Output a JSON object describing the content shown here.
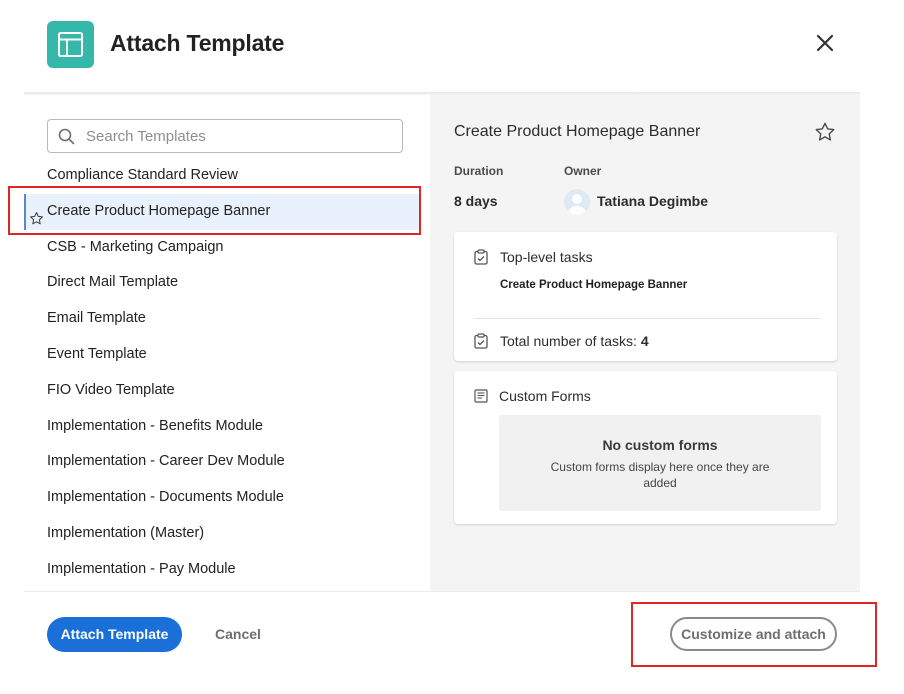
{
  "dialog": {
    "title": "Attach Template",
    "app_icon": "template-layout-icon",
    "close_icon": "close-icon"
  },
  "search": {
    "placeholder": "Search Templates",
    "value": ""
  },
  "templates": [
    {
      "label": "Compliance Standard Review",
      "selected": false
    },
    {
      "label": "Create Product Homepage Banner",
      "selected": true
    },
    {
      "label": "CSB - Marketing Campaign",
      "selected": false
    },
    {
      "label": "Direct Mail Template",
      "selected": false
    },
    {
      "label": "Email Template",
      "selected": false
    },
    {
      "label": "Event Template",
      "selected": false
    },
    {
      "label": "FIO Video Template",
      "selected": false
    },
    {
      "label": "Implementation - Benefits Module",
      "selected": false
    },
    {
      "label": "Implementation - Career Dev Module",
      "selected": false
    },
    {
      "label": "Implementation - Documents Module",
      "selected": false
    },
    {
      "label": "Implementation (Master)",
      "selected": false
    },
    {
      "label": "Implementation - Pay Module",
      "selected": false
    }
  ],
  "details": {
    "title": "Create Product Homepage Banner",
    "duration_label": "Duration",
    "duration_value": "8 days",
    "owner_label": "Owner",
    "owner_name": "Tatiana Degimbe",
    "tasks_card": {
      "heading": "Top-level tasks",
      "task_name": "Create Product Homepage Banner",
      "total_label": "Total number of tasks:",
      "total_value": "4"
    },
    "forms_card": {
      "heading": "Custom Forms",
      "empty_title": "No custom forms",
      "empty_desc": "Custom forms display here once they are added"
    }
  },
  "footer": {
    "attach_label": "Attach Template",
    "cancel_label": "Cancel",
    "customize_label": "Customize and attach"
  },
  "colors": {
    "accent": "#1a6fd8",
    "app_icon": "#35b8a9",
    "selected_row": "#e8f1fc",
    "annotation": "#e02525"
  }
}
